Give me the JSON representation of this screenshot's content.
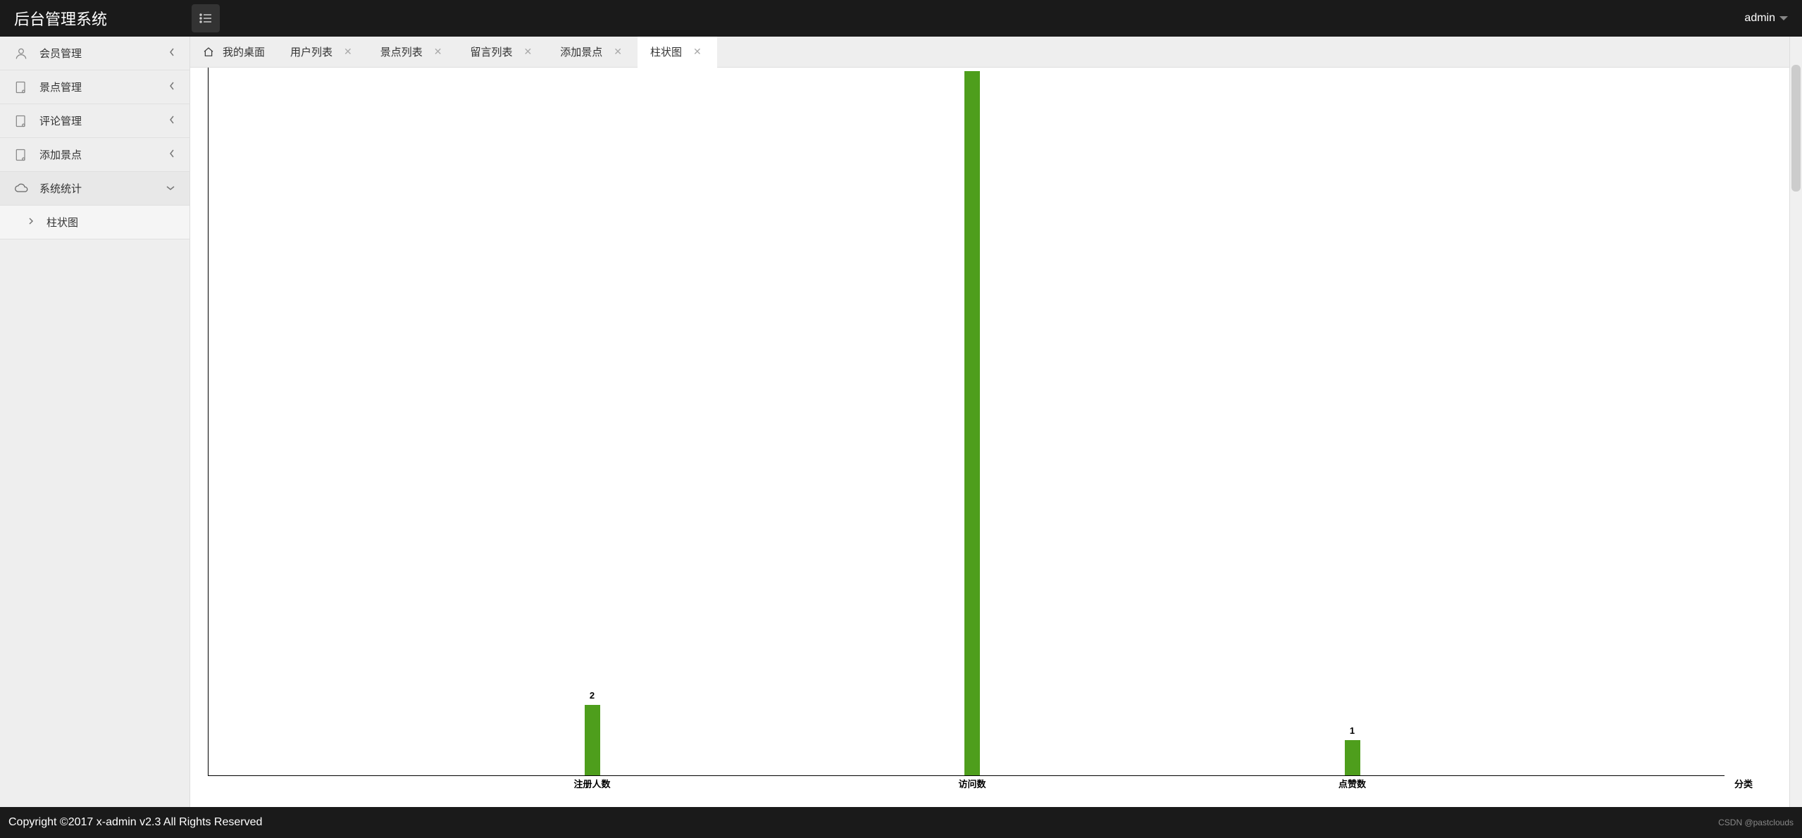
{
  "header": {
    "title": "后台管理系统",
    "user": "admin"
  },
  "sidebar": {
    "items": [
      {
        "label": "会员管理",
        "icon": "user"
      },
      {
        "label": "景点管理",
        "icon": "doc"
      },
      {
        "label": "评论管理",
        "icon": "doc"
      },
      {
        "label": "添加景点",
        "icon": "doc"
      },
      {
        "label": "系统统计",
        "icon": "cloud",
        "expanded": true
      }
    ],
    "sub": {
      "label": "柱状图"
    }
  },
  "tabs": {
    "items": [
      {
        "label": "我的桌面",
        "home": true,
        "closable": false
      },
      {
        "label": "用户列表",
        "closable": true
      },
      {
        "label": "景点列表",
        "closable": true
      },
      {
        "label": "留言列表",
        "closable": true
      },
      {
        "label": "添加景点",
        "closable": true
      },
      {
        "label": "柱状图",
        "closable": true,
        "active": true
      }
    ]
  },
  "chart_data": {
    "type": "bar",
    "categories": [
      "注册人数",
      "访问数",
      "点赞数"
    ],
    "values": [
      2,
      20,
      1
    ],
    "xlabel": "分类",
    "ylabel": "",
    "bar_color": "#4e9e1c",
    "visible_labels": {
      "注册人数": "2",
      "点赞数": "1"
    }
  },
  "footer": {
    "copyright": "Copyright ©2017 x-admin v2.3 All Rights Reserved",
    "watermark": "CSDN @pastclouds"
  }
}
